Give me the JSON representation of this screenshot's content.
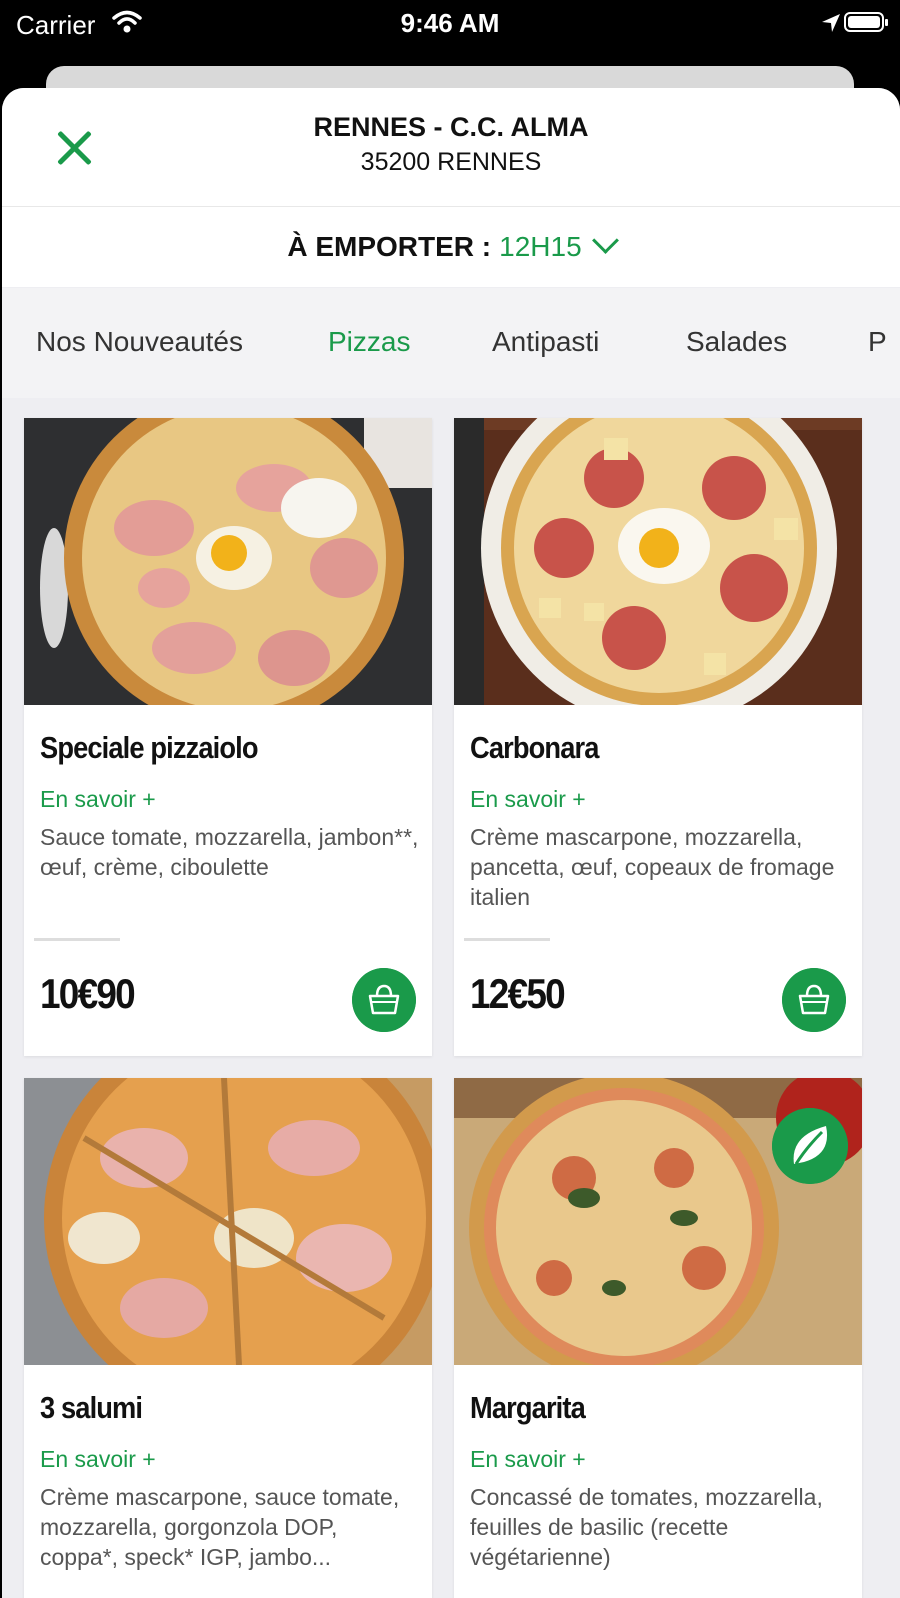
{
  "status_bar": {
    "carrier": "Carrier",
    "time": "9:46 AM"
  },
  "header": {
    "store_name": "RENNES - C.C. ALMA",
    "store_city": "35200 RENNES"
  },
  "pickup": {
    "label": "À EMPORTER :",
    "time": "12H15"
  },
  "categories": [
    {
      "label": "Nos Nouveautés",
      "active": false
    },
    {
      "label": "Pizzas",
      "active": true
    },
    {
      "label": "Antipasti",
      "active": false
    },
    {
      "label": "Salades",
      "active": false
    },
    {
      "label": "P",
      "active": false
    }
  ],
  "products": [
    {
      "name": "Speciale pizzaiolo",
      "more": "En savoir +",
      "description": "Sauce tomate, mozzarella, jambon**, œuf, crème, ciboulette",
      "price": "10€90"
    },
    {
      "name": "Carbonara",
      "more": "En savoir +",
      "description": "Crème mascarpone, mozzarella, pancetta, œuf, copeaux de fromage italien",
      "price": "12€50"
    },
    {
      "name": "3 salumi",
      "more": "En savoir +",
      "description": "Crème mascarpone, sauce tomate, mozzarella, gorgonzola DOP, coppa*, speck* IGP, jambo...",
      "price": ""
    },
    {
      "name": "Margarita",
      "more": "En savoir +",
      "description": "Concassé de tomates, mozzarella, feuilles de basilic (recette végétarienne)",
      "price": "",
      "vegetarian": true
    }
  ],
  "colors": {
    "accent": "#1a9a4a",
    "background": "#eeeef2"
  },
  "icons": [
    "wifi-icon",
    "location-arrow-icon",
    "battery-icon",
    "close-icon",
    "chevron-down-icon",
    "basket-icon",
    "leaf-icon"
  ]
}
